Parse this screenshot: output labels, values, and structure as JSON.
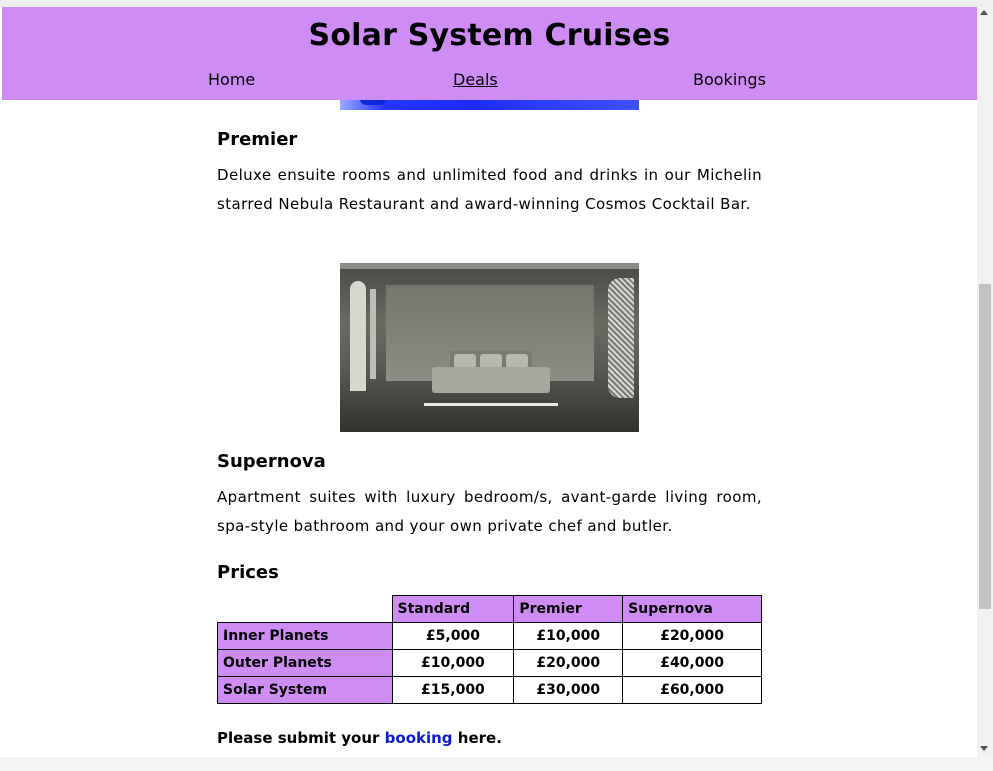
{
  "header": {
    "title": "Solar System Cruises",
    "nav": {
      "home": "Home",
      "deals": "Deals",
      "bookings": "Bookings"
    }
  },
  "colors": {
    "accent": "#cf8cf4",
    "link": "#0a1bd6"
  },
  "sections": {
    "premier": {
      "heading": "Premier",
      "text": "Deluxe ensuite rooms and unlimited food and drinks in our Michelin starred Nebula Restaurant and award-winning Cosmos Cocktail Bar."
    },
    "supernova": {
      "heading": "Supernova",
      "text": "Apartment suites with luxury bedroom/s, avant-garde living room, spa-style bathroom and your own private chef and butler."
    }
  },
  "prices": {
    "heading": "Prices",
    "columns": [
      "Standard",
      "Premier",
      "Supernova"
    ],
    "rows": [
      {
        "label": "Inner Planets",
        "values": [
          "£5,000",
          "£10,000",
          "£20,000"
        ]
      },
      {
        "label": "Outer Planets",
        "values": [
          "£10,000",
          "£20,000",
          "£40,000"
        ]
      },
      {
        "label": "Solar System",
        "values": [
          "£15,000",
          "£30,000",
          "£60,000"
        ]
      }
    ]
  },
  "footer_line": {
    "before": "Please submit your",
    "link": "booking",
    "after": "here."
  }
}
